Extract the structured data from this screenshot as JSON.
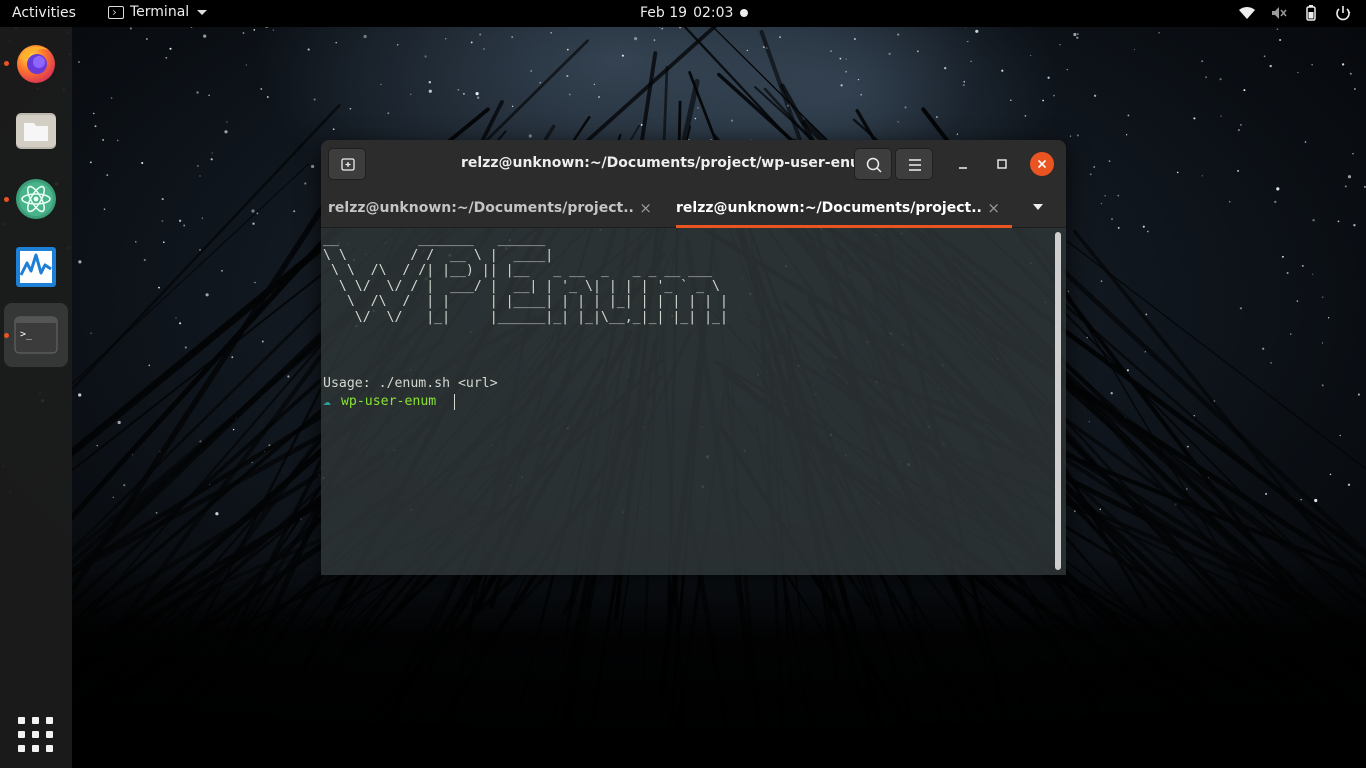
{
  "topbar": {
    "activities_label": "Activities",
    "app_name": "Terminal",
    "date": "Feb 19",
    "time": "02:03",
    "tray_icons": [
      "wifi-icon",
      "volume-muted-icon",
      "battery-icon",
      "power-icon"
    ]
  },
  "dock": {
    "items": [
      {
        "name": "Firefox",
        "icon": "firefox-icon",
        "running": true
      },
      {
        "name": "Files",
        "icon": "files-icon",
        "running": false
      },
      {
        "name": "Atom",
        "icon": "atom-icon",
        "running": true
      },
      {
        "name": "System Monitor",
        "icon": "system-monitor-icon",
        "running": false
      },
      {
        "name": "Terminal",
        "icon": "terminal-icon",
        "running": true,
        "active": true
      }
    ],
    "show_apps_icon": "app-grid-icon"
  },
  "terminal": {
    "window_title": "relzz@unknown:~/Documents/project/wp-user-enum",
    "tabs": [
      {
        "label": "relzz@unknown:~/Documents/project...",
        "active": false
      },
      {
        "label": "relzz@unknown:~/Documents/project...",
        "active": true
      }
    ],
    "tab_close_glyph": "×",
    "banner": "__          _______   ______\n\\ \\        / /  __ \\ |  ____|\n \\ \\  /\\  / /| |__) || |__   _ __  _   _ _ __ ___\n  \\ \\/  \\/ / |  ___/ |  __| | '_ \\| | | | '_ ` _ \\\n   \\  /\\  /  | |     | |____| | | | |_| | | | | | |\n    \\/  \\/   |_|     |______|_| |_|\\__,_|_| |_| |_|",
    "usage_line": "Usage: ./enum.sh <url>",
    "prompt_symbol": "☁",
    "prompt_dir": "wp-user-enum",
    "colors": {
      "accent": "#e95420",
      "prompt_symbol": "#2aa198",
      "prompt_dir": "#8ae234",
      "text": "#d3d7cf"
    }
  }
}
